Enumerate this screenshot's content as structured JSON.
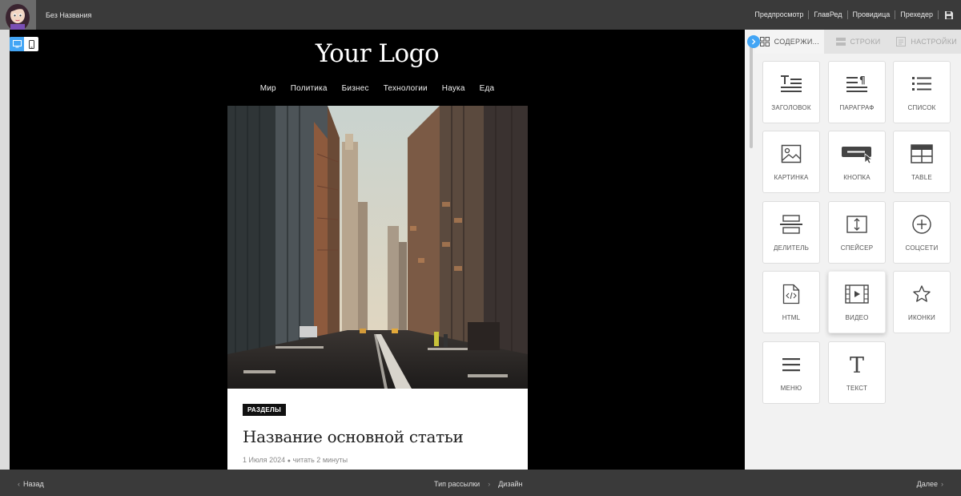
{
  "header": {
    "doc_title": "Без Названия",
    "links": [
      "Предпросмотр",
      "ГлавРед",
      "Провидица",
      "Прехедер"
    ]
  },
  "canvas": {
    "logo": "Your Logo",
    "nav": [
      "Мир",
      "Политика",
      "Бизнес",
      "Технологии",
      "Наука",
      "Еда"
    ],
    "article": {
      "tag": "РАЗДЕЛЫ",
      "title": "Название основной статьи",
      "date": "1 Июля 2024",
      "separator": "●",
      "read_time": "читать 2 минуты"
    }
  },
  "panel": {
    "tabs": [
      "СОДЕРЖИ...",
      "СТРОКИ",
      "НАСТРОЙКИ"
    ],
    "tiles": [
      {
        "label": "ЗАГОЛОВОК",
        "icon": "heading-icon"
      },
      {
        "label": "ПАРАГРАФ",
        "icon": "paragraph-icon"
      },
      {
        "label": "СПИСОК",
        "icon": "list-icon"
      },
      {
        "label": "КАРТИНКА",
        "icon": "image-icon"
      },
      {
        "label": "КНОПКА",
        "icon": "button-icon"
      },
      {
        "label": "TABLE",
        "icon": "table-icon"
      },
      {
        "label": "ДЕЛИТЕЛЬ",
        "icon": "divider-icon"
      },
      {
        "label": "СПЕЙСЕР",
        "icon": "spacer-icon"
      },
      {
        "label": "СОЦСЕТИ",
        "icon": "social-icon"
      },
      {
        "label": "HTML",
        "icon": "html-icon"
      },
      {
        "label": "ВИДЕО",
        "icon": "video-icon"
      },
      {
        "label": "ИКОНКИ",
        "icon": "star-icon"
      },
      {
        "label": "МЕНЮ",
        "icon": "menu-icon"
      },
      {
        "label": "ТЕКСТ",
        "icon": "text-icon"
      }
    ]
  },
  "footer": {
    "back": "Назад",
    "crumb1": "Тип рассылки",
    "crumb2": "Дизайн",
    "next": "Далее"
  },
  "colors": {
    "accent": "#42a5f5",
    "bar": "#3a3a3a"
  }
}
